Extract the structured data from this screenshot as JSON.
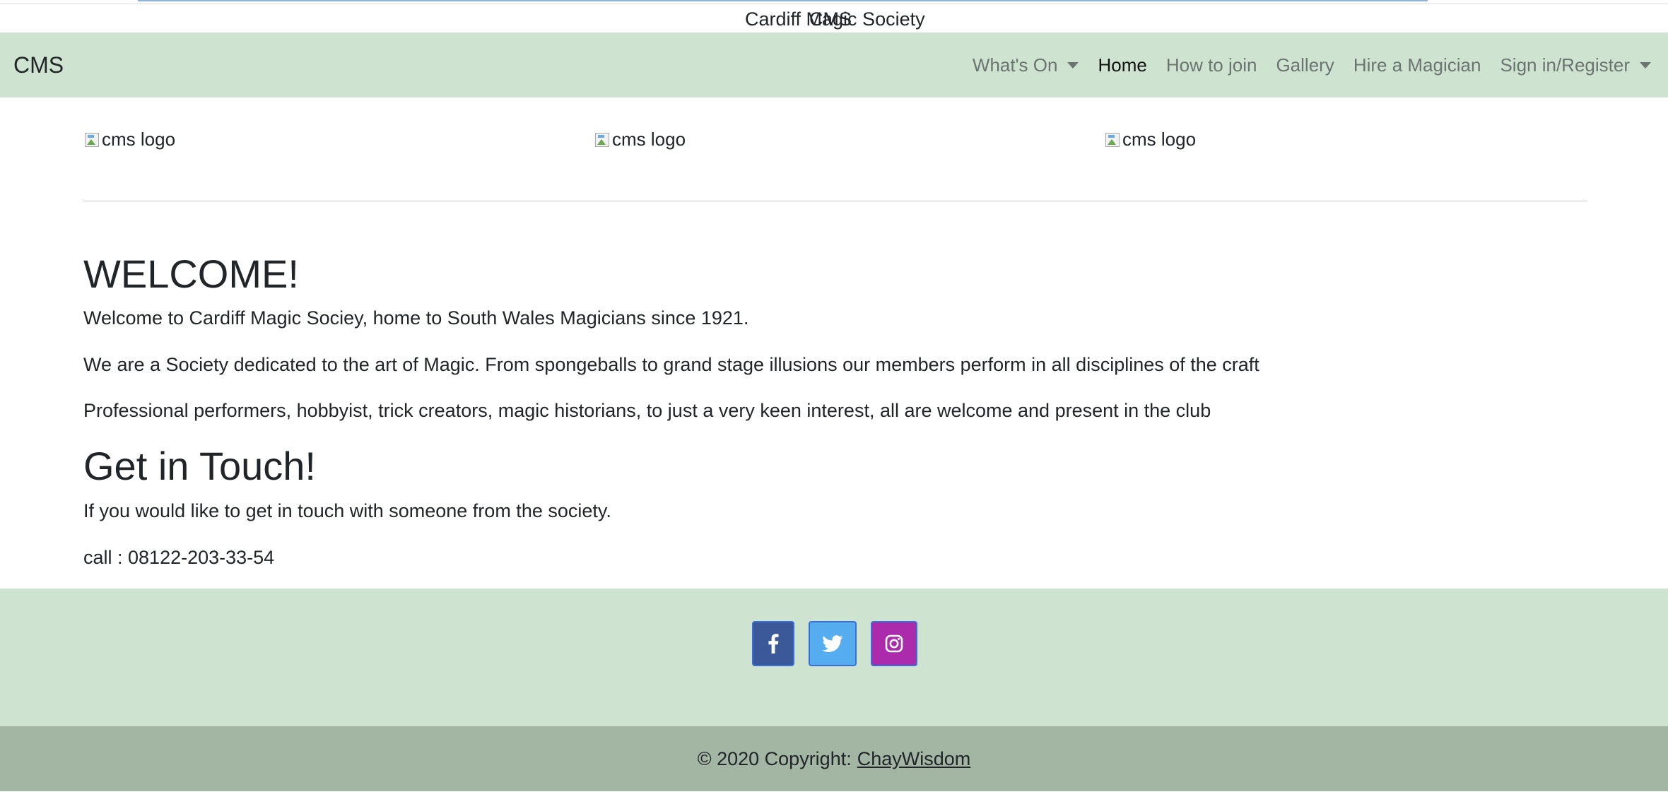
{
  "top_strip": {
    "title_text_a": "Cardiff Magic Society",
    "title_text_b": "CMS"
  },
  "navbar": {
    "brand": "CMS",
    "items": [
      {
        "label": "What's On",
        "dropdown": true,
        "active": false
      },
      {
        "label": "Home",
        "dropdown": false,
        "active": true
      },
      {
        "label": "How to join",
        "dropdown": false,
        "active": false
      },
      {
        "label": "Gallery",
        "dropdown": false,
        "active": false
      },
      {
        "label": "Hire a Magician",
        "dropdown": false,
        "active": false
      },
      {
        "label": "Sign in/Register",
        "dropdown": true,
        "active": false
      }
    ],
    "background": "#cfe4d0"
  },
  "logos": [
    {
      "alt": "cms logo"
    },
    {
      "alt": "cms logo"
    },
    {
      "alt": "cms logo"
    }
  ],
  "main": {
    "welcome_heading": "WELCOME!",
    "welcome_paragraphs": [
      "Welcome to Cardiff Magic Sociey, home to South Wales Magicians since 1921.",
      "We are a Society dedicated to the art of Magic. From spongeballs to grand stage illusions our members perform in all disciplines of the craft",
      "Professional performers, hobbyist, trick creators, magic historians, to just a very keen interest, all are welcome and present in the club"
    ],
    "contact_heading": "Get in Touch!",
    "contact_text": "If you would like to get in touch with someone from the society.",
    "phone_line": "call : 08122-203-33-54"
  },
  "footer": {
    "social_icons": [
      {
        "name": "facebook-icon",
        "color": "#3b5998"
      },
      {
        "name": "twitter-icon",
        "color": "#55acee"
      },
      {
        "name": "instagram-icon",
        "color": "#ac2bac"
      }
    ],
    "copyright_prefix": "© 2020 Copyright:",
    "copyright_link": "ChayWisdom",
    "background": "#cfe4d0",
    "copyright_background": "#a3b5a3"
  }
}
